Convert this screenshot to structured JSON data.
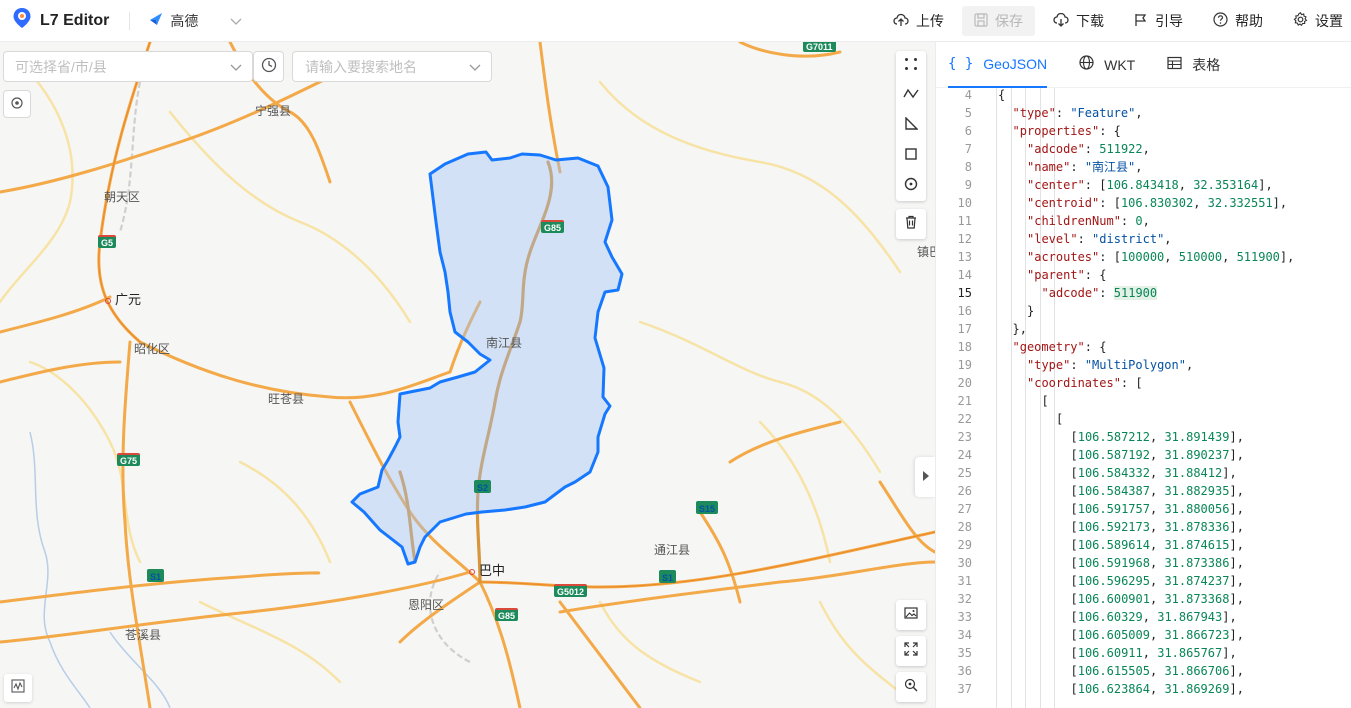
{
  "app": {
    "title": "L7 Editor",
    "map_source": "高德"
  },
  "toolbar": {
    "upload": "上传",
    "save": "保存",
    "download": "下载",
    "guide": "引导",
    "help": "帮助",
    "settings": "设置"
  },
  "map_controls": {
    "region_placeholder": "可选择省/市/县",
    "search_placeholder": "请输入要搜索地名"
  },
  "map_labels": {
    "places": [
      "宁强县",
      "朝天区",
      "广元",
      "昭化区",
      "旺苍县",
      "南江县",
      "巴中",
      "恩阳区",
      "苍溪县",
      "通江县",
      "镇巴"
    ],
    "roads": [
      "G7011",
      "G5",
      "G75",
      "G85",
      "S2",
      "S15",
      "S1",
      "G5012",
      "G85",
      "S1"
    ]
  },
  "panel": {
    "tabs": [
      "GeoJSON",
      "WKT",
      "表格"
    ],
    "active_tab": "GeoJSON",
    "current_line": 15,
    "lines": [
      {
        "n": 4,
        "i": 0,
        "t": "{"
      },
      {
        "n": 5,
        "i": 1,
        "t": "\"type\": \"Feature\","
      },
      {
        "n": 6,
        "i": 1,
        "t": "\"properties\": {"
      },
      {
        "n": 7,
        "i": 2,
        "t": "\"adcode\": 511922,"
      },
      {
        "n": 8,
        "i": 2,
        "t": "\"name\": \"南江县\","
      },
      {
        "n": 9,
        "i": 2,
        "t": "\"center\": [106.843418, 32.353164],"
      },
      {
        "n": 10,
        "i": 2,
        "t": "\"centroid\": [106.830302, 32.332551],"
      },
      {
        "n": 11,
        "i": 2,
        "t": "\"childrenNum\": 0,"
      },
      {
        "n": 12,
        "i": 2,
        "t": "\"level\": \"district\","
      },
      {
        "n": 13,
        "i": 2,
        "t": "\"acroutes\": [100000, 510000, 511900],"
      },
      {
        "n": 14,
        "i": 2,
        "t": "\"parent\": {"
      },
      {
        "n": 15,
        "i": 3,
        "t": "\"adcode\": 511900"
      },
      {
        "n": 16,
        "i": 2,
        "t": "}"
      },
      {
        "n": 17,
        "i": 1,
        "t": "},"
      },
      {
        "n": 18,
        "i": 1,
        "t": "\"geometry\": {"
      },
      {
        "n": 19,
        "i": 2,
        "t": "\"type\": \"MultiPolygon\","
      },
      {
        "n": 20,
        "i": 2,
        "t": "\"coordinates\": ["
      },
      {
        "n": 21,
        "i": 3,
        "t": "["
      },
      {
        "n": 22,
        "i": 4,
        "t": "["
      },
      {
        "n": 23,
        "i": 5,
        "t": "[106.587212, 31.891439],"
      },
      {
        "n": 24,
        "i": 5,
        "t": "[106.587192, 31.890237],"
      },
      {
        "n": 25,
        "i": 5,
        "t": "[106.584332, 31.88412],"
      },
      {
        "n": 26,
        "i": 5,
        "t": "[106.584387, 31.882935],"
      },
      {
        "n": 27,
        "i": 5,
        "t": "[106.591757, 31.880056],"
      },
      {
        "n": 28,
        "i": 5,
        "t": "[106.592173, 31.878336],"
      },
      {
        "n": 29,
        "i": 5,
        "t": "[106.589614, 31.874615],"
      },
      {
        "n": 30,
        "i": 5,
        "t": "[106.591968, 31.873386],"
      },
      {
        "n": 31,
        "i": 5,
        "t": "[106.596295, 31.874237],"
      },
      {
        "n": 32,
        "i": 5,
        "t": "[106.600901, 31.873368],"
      },
      {
        "n": 33,
        "i": 5,
        "t": "[106.60329, 31.867943],"
      },
      {
        "n": 34,
        "i": 5,
        "t": "[106.605009, 31.866723],"
      },
      {
        "n": 35,
        "i": 5,
        "t": "[106.60911, 31.865767],"
      },
      {
        "n": 36,
        "i": 5,
        "t": "[106.615505, 31.866706],"
      },
      {
        "n": 37,
        "i": 5,
        "t": "[106.623864, 31.869269],"
      }
    ]
  }
}
